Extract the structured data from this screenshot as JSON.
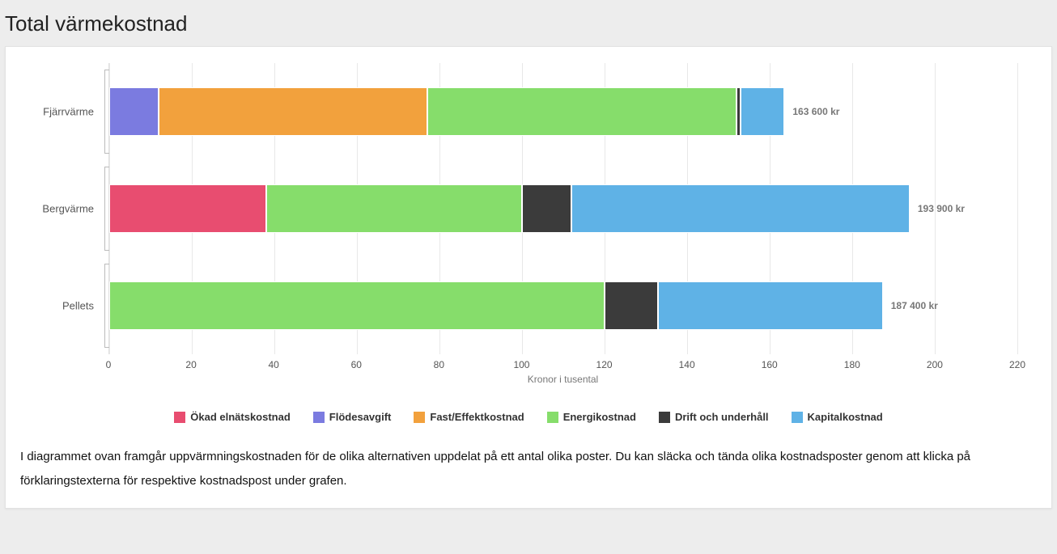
{
  "title": "Total värmekostnad",
  "chart_data": {
    "type": "bar",
    "orientation": "horizontal",
    "stacked": true,
    "xlabel": "Kronor i tusental",
    "ylabel": "",
    "xlim": [
      0,
      220
    ],
    "x_ticks": [
      0,
      20,
      40,
      60,
      80,
      100,
      120,
      140,
      160,
      180,
      200,
      220
    ],
    "categories": [
      "Fjärrvärme",
      "Bergvärme",
      "Pellets"
    ],
    "series": [
      {
        "name": "Ökad elnätskostnad",
        "color": "#e84d70",
        "values": [
          0,
          38,
          0
        ]
      },
      {
        "name": "Flödesavgift",
        "color": "#7b7be0",
        "values": [
          12,
          0,
          0
        ]
      },
      {
        "name": "Fast/Effektkostnad",
        "color": "#f2a13d",
        "values": [
          65,
          0,
          0
        ]
      },
      {
        "name": "Energikostnad",
        "color": "#86dd6b",
        "values": [
          75,
          62,
          120
        ]
      },
      {
        "name": "Drift och underhåll",
        "color": "#3b3b3b",
        "values": [
          1,
          12,
          13
        ]
      },
      {
        "name": "Kapitalkostnad",
        "color": "#5fb2e6",
        "values": [
          10.6,
          81.9,
          54.4
        ]
      }
    ],
    "totals_label": [
      "163 600 kr",
      "193 900 kr",
      "187 400 kr"
    ],
    "totals_value": [
      163.6,
      193.9,
      187.4
    ]
  },
  "description": "I diagrammet ovan framgår uppvärmningskostnaden för de olika alternativen uppdelat på ett antal olika poster. Du kan släcka och tända olika kostnadsposter genom att klicka på förklaringstexterna för respektive kostnadspost under grafen."
}
